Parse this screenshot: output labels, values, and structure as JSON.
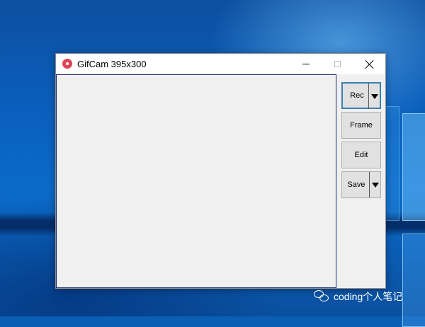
{
  "window": {
    "title": "GifCam 395x300",
    "app_icon": "camera-icon",
    "controls": {
      "minimize_icon": "minimize-icon",
      "maximize_icon": "maximize-icon",
      "close_icon": "close-icon"
    }
  },
  "sidebar": {
    "rec_label": "Rec",
    "frame_label": "Frame",
    "edit_label": "Edit",
    "save_label": "Save",
    "dropdown_icon": "triangle-down-icon"
  },
  "watermark": {
    "text": "coding个人笔记",
    "icon": "wechat-icon"
  },
  "colors": {
    "desktop_accent": "#0a5fb4",
    "app_icon": "#e0455a",
    "focus_border": "#3c7fb1"
  }
}
